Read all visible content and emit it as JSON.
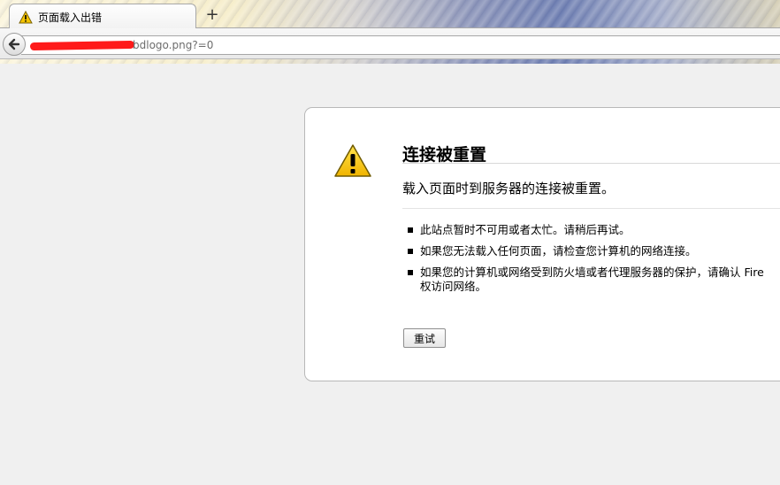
{
  "tab": {
    "title": "页面载入出错",
    "icon": "warning-icon"
  },
  "toolbar": {
    "new_tab_label": "+",
    "back_icon": "back-arrow-icon"
  },
  "address_bar": {
    "url_visible": "bdlogo.png?=0",
    "redacted": true
  },
  "error_page": {
    "icon": "warning-icon",
    "title": "连接被重置",
    "short_desc": "载入页面时到服务器的连接被重置。",
    "items": [
      {
        "lines": [
          "此站点暂时不可用或者太忙。请稍后再试。"
        ]
      },
      {
        "lines": [
          "如果您无法载入任何页面，请检查您计算机的网络连接。"
        ]
      },
      {
        "lines": [
          "如果您的计算机或网络受到防火墙或者代理服务器的保护，请确认 Fire",
          "权访问网络。"
        ]
      }
    ],
    "retry_label": "重试"
  },
  "colors": {
    "page_background": "#f0f0f0",
    "card_background": "#ffffff",
    "warning_yellow": "#f5c400",
    "redaction": "#ff1a1a"
  }
}
